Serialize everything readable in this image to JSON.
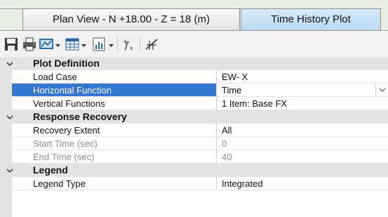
{
  "tabs": [
    {
      "label": "Plan View - N +18.00 - Z = 18 (m)",
      "active": false
    },
    {
      "label": "Time History Plot",
      "active": true
    }
  ],
  "toolbar": {
    "icons": [
      "save-icon",
      "print-icon",
      "display-icon",
      "table-icon",
      "chart-icon",
      "function-icon",
      "axes-icon"
    ]
  },
  "properties": {
    "plot_definition": {
      "title": "Plot Definition",
      "rows": [
        {
          "name": "Load Case",
          "value": "EW- X"
        },
        {
          "name": "Horizontal Function",
          "value": "Time"
        },
        {
          "name": "Vertical Functions",
          "value": "1 Item: Base FX"
        }
      ]
    },
    "response_recovery": {
      "title": "Response Recovery",
      "rows": [
        {
          "name": "Recovery Extent",
          "value": "All"
        },
        {
          "name": "Start Time (sec)",
          "value": "0"
        },
        {
          "name": "End Time (sec)",
          "value": "40"
        }
      ]
    },
    "legend": {
      "title": "Legend",
      "rows": [
        {
          "name": "Legend Type",
          "value": "Integrated"
        }
      ]
    }
  },
  "colors": {
    "selection": "#3377d0",
    "active_tab": "#c6e1f7",
    "category_bg": "#e3e3e3"
  }
}
